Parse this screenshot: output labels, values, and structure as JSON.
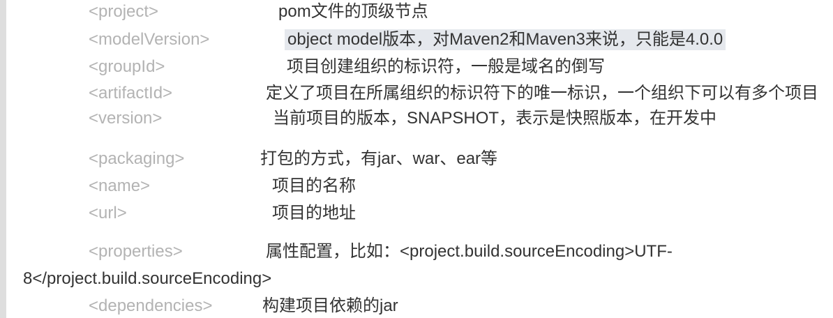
{
  "rows": [
    {
      "tag": "<project>",
      "desc": "pom文件的顶级节点"
    },
    {
      "tag": "<modelVersion>",
      "desc": "object model版本，对Maven2和Maven3来说，只能是4.0.0"
    },
    {
      "tag": "<groupId>",
      "desc": "项目创建组织的标识符，一般是域名的倒写"
    },
    {
      "tag": "<artifactId>",
      "desc": "定义了项目在所属组织的标识符下的唯一标识，一个组织下可以有多个项目"
    },
    {
      "tag": "<version>",
      "desc": "当前项目的版本，SNAPSHOT，表示是快照版本，在开发中"
    },
    {
      "tag": "<packaging>",
      "desc": "打包的方式，有jar、war、ear等"
    },
    {
      "tag": "<name>",
      "desc": "项目的名称"
    },
    {
      "tag": "<url>",
      "desc": "项目的地址"
    },
    {
      "tag": "<properties>",
      "desc": "属性配置，比如：<project.build.sourceEncoding>UTF-",
      "desc_continued": "8</project.build.sourceEncoding>"
    },
    {
      "tag": "<dependencies>",
      "desc": "构建项目依赖的jar"
    }
  ],
  "colors": {
    "tag_text": "#b3b3b3",
    "desc_text": "#333333",
    "highlight": "#e5e8ed",
    "left_border": "#dedede"
  }
}
